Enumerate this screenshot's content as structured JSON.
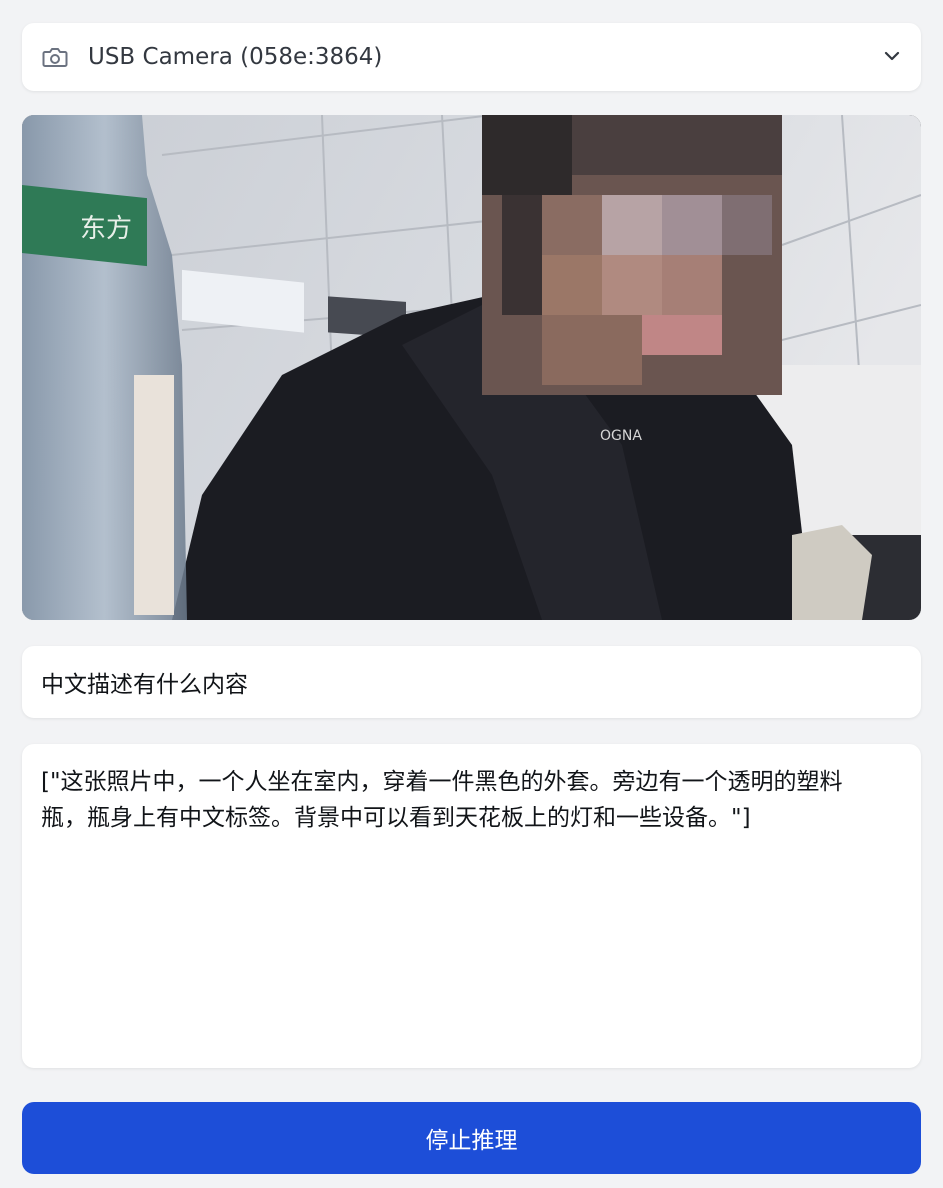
{
  "camera_select": {
    "selected": "USB Camera (058e:3864)",
    "icon": "camera-icon"
  },
  "prompt": {
    "value": "中文描述有什么内容"
  },
  "output": {
    "text": "[\"这张照片中，一个人坐在室内，穿着一件黑色的外套。旁边有一个透明的塑料瓶，瓶身上有中文标签。背景中可以看到天花板上的灯和一些设备。\"]"
  },
  "action": {
    "stop_label": "停止推理"
  },
  "bottle_label": "东方",
  "shirt_text": "OGNA",
  "colors": {
    "primary": "#1d4ed8",
    "background": "#f2f3f5",
    "card": "#ffffff"
  }
}
